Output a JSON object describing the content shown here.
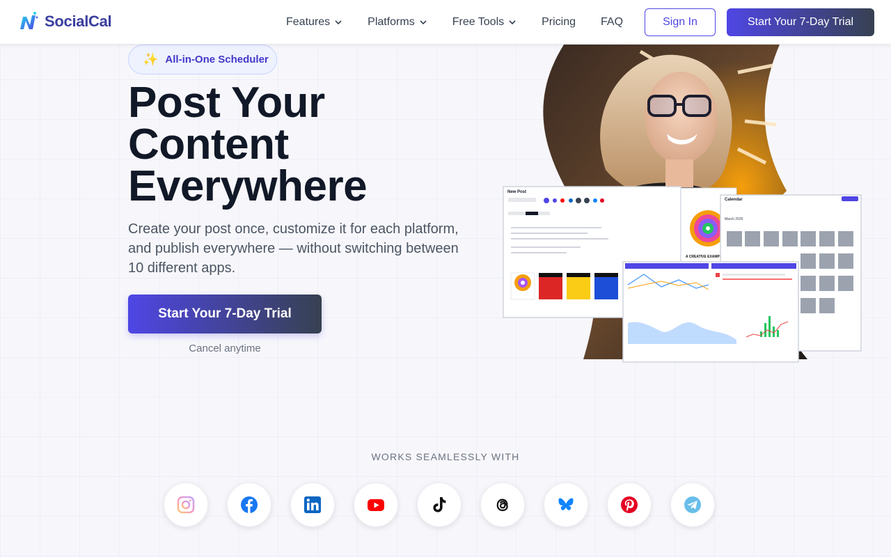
{
  "brand": {
    "name": "SocialCal",
    "logo_icon": "socialcal-logo-icon"
  },
  "nav": {
    "items": [
      {
        "label": "Features",
        "has_dropdown": true
      },
      {
        "label": "Platforms",
        "has_dropdown": true
      },
      {
        "label": "Free Tools",
        "has_dropdown": true
      },
      {
        "label": "Pricing",
        "has_dropdown": false
      },
      {
        "label": "FAQ",
        "has_dropdown": false
      }
    ],
    "signin_label": "Sign In",
    "trial_label": "Start Your 7-Day Trial"
  },
  "hero": {
    "badge": "All-in-One Scheduler",
    "badge_icon": "sparkles-icon",
    "title_lines": [
      "Post Your",
      "Content",
      "Everywhere"
    ],
    "subtitle_lines": [
      "Create your post once, customize it for each platform,",
      "and publish everywhere — without switching between",
      "10 different apps."
    ],
    "cta_label": "Start Your 7-Day Trial",
    "cta_note": "Cancel anytime",
    "screens": {
      "new_post_title": "New Post",
      "calendar_title": "Calendar",
      "calendar_month": "March 2026",
      "preview_caption": "A CREATIVE EXAMPLE OF THE USE OF COLOR"
    }
  },
  "platforms": {
    "heading": "WORKS SEAMLESSLY WITH",
    "items": [
      {
        "name": "Instagram",
        "icon": "instagram-icon",
        "color": "#e1306c"
      },
      {
        "name": "Facebook",
        "icon": "facebook-icon",
        "color": "#1877f2"
      },
      {
        "name": "LinkedIn",
        "icon": "linkedin-icon",
        "color": "#0a66c2"
      },
      {
        "name": "YouTube",
        "icon": "youtube-icon",
        "color": "#ff0000"
      },
      {
        "name": "TikTok",
        "icon": "tiktok-icon",
        "color": "#000000"
      },
      {
        "name": "Threads",
        "icon": "threads-icon",
        "color": "#000000"
      },
      {
        "name": "Bluesky",
        "icon": "bluesky-icon",
        "color": "#1185fe"
      },
      {
        "name": "Pinterest",
        "icon": "pinterest-icon",
        "color": "#e60023"
      },
      {
        "name": "Telegram",
        "icon": "telegram-icon",
        "color": "#2aa3e0"
      }
    ]
  },
  "colors": {
    "accent": "#4f46e5",
    "accent_dark": "#374151",
    "title": "#111827"
  }
}
